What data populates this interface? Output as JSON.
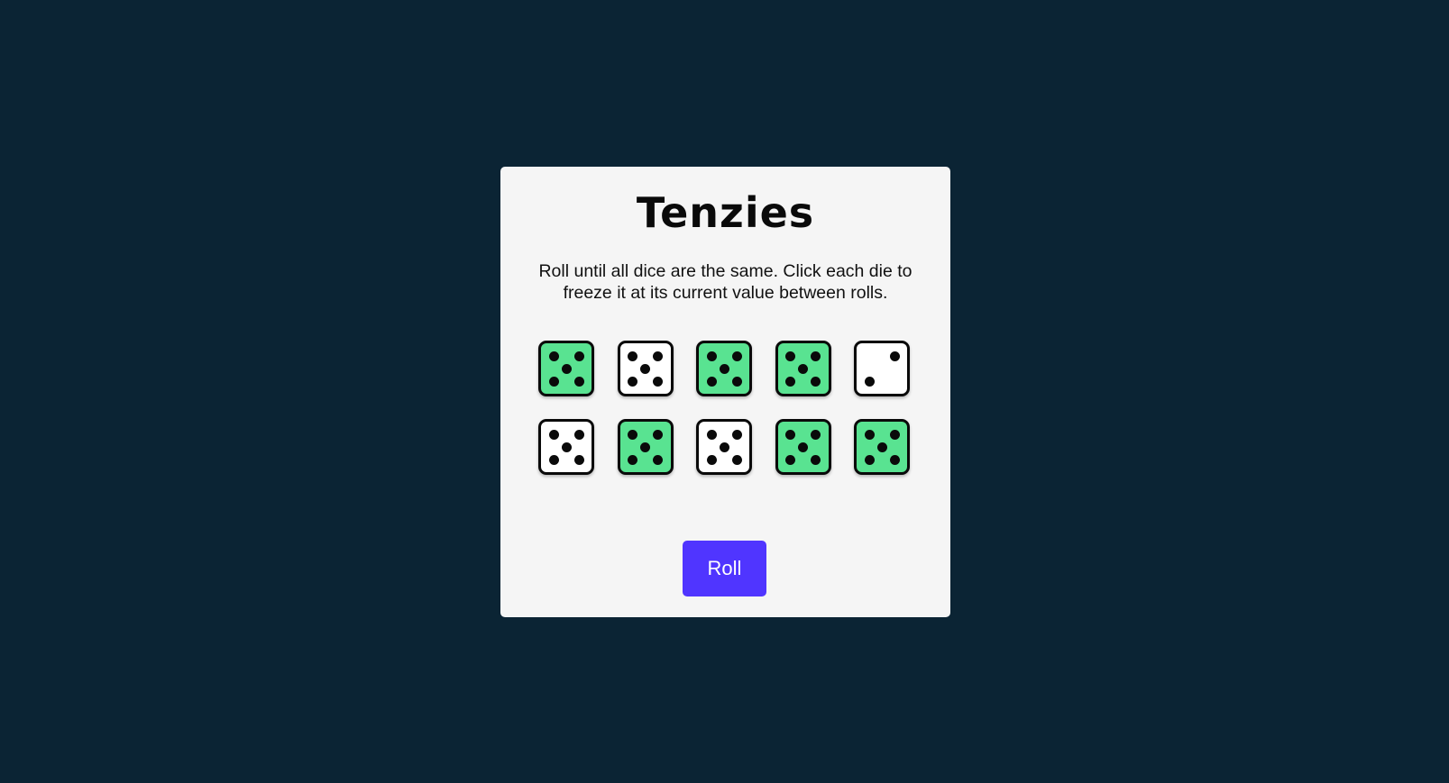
{
  "game": {
    "title": "Tenzies",
    "instructions": "Roll until all dice are the same. Click each die to freeze it at its current value between rolls.",
    "roll_label": "Roll"
  },
  "colors": {
    "background": "#0B2434",
    "board": "#F5F5F5",
    "held_die": "#59E391",
    "free_die": "#FFFFFF",
    "button": "#5035FF"
  },
  "dice": [
    {
      "value": 5,
      "held": true
    },
    {
      "value": 5,
      "held": false
    },
    {
      "value": 5,
      "held": true
    },
    {
      "value": 5,
      "held": true
    },
    {
      "value": 2,
      "held": false
    },
    {
      "value": 5,
      "held": false
    },
    {
      "value": 5,
      "held": true
    },
    {
      "value": 5,
      "held": false
    },
    {
      "value": 5,
      "held": true
    },
    {
      "value": 5,
      "held": true
    }
  ]
}
